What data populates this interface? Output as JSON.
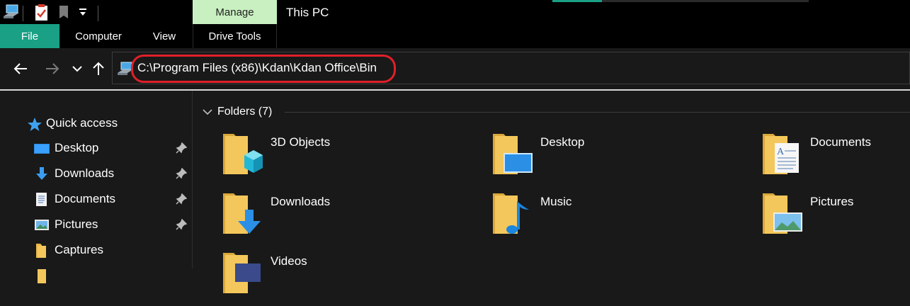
{
  "quick_access_toolbar": {
    "icons": [
      "pc-icon",
      "properties-checklist-icon",
      "new-folder-icon",
      "customize-dropdown-icon"
    ]
  },
  "ribbon": {
    "context_group_label": "Manage",
    "window_title": "This PC",
    "tabs": [
      {
        "label": "File"
      },
      {
        "label": "Computer"
      },
      {
        "label": "View"
      },
      {
        "label": "Drive Tools"
      }
    ]
  },
  "navigation": {
    "back": "arrow-left-icon",
    "forward": "arrow-right-icon",
    "recent": "chevron-down-icon",
    "up": "arrow-up-icon"
  },
  "address_bar": {
    "path": "C:\\Program Files (x86)\\Kdan\\Kdan Office\\Bin",
    "highlight_color": "#e0202a"
  },
  "sidebar": {
    "quick_access_label": "Quick access",
    "items": [
      {
        "label": "Desktop",
        "icon": "desktop-icon",
        "pinned": true
      },
      {
        "label": "Downloads",
        "icon": "downloads-icon",
        "pinned": true
      },
      {
        "label": "Documents",
        "icon": "documents-icon",
        "pinned": true
      },
      {
        "label": "Pictures",
        "icon": "pictures-icon",
        "pinned": true
      },
      {
        "label": "Captures",
        "icon": "folder-icon",
        "pinned": false
      }
    ]
  },
  "main": {
    "group_label": "Folders (7)",
    "folders": [
      {
        "name": "3D Objects",
        "icon": "3d-objects-icon"
      },
      {
        "name": "Desktop",
        "icon": "desktop-folder-icon"
      },
      {
        "name": "Documents",
        "icon": "documents-folder-icon"
      },
      {
        "name": "Downloads",
        "icon": "downloads-folder-icon"
      },
      {
        "name": "Music",
        "icon": "music-folder-icon"
      },
      {
        "name": "Pictures",
        "icon": "pictures-folder-icon"
      },
      {
        "name": "Videos",
        "icon": "videos-folder-icon"
      }
    ]
  },
  "colors": {
    "accent": "#1aa085",
    "manage_tab": "#c8f0c0",
    "background": "#191919",
    "folder": "#f3c75b"
  }
}
